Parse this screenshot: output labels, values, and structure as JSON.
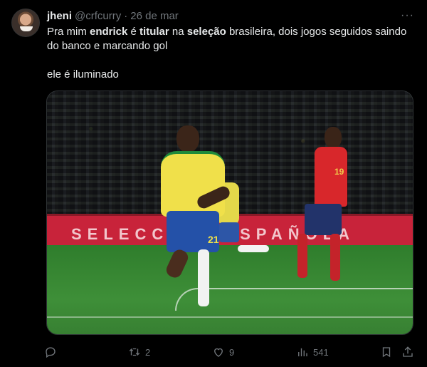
{
  "tweet": {
    "author": {
      "name": "jheni",
      "handle": "@crfcurry",
      "separator": "·",
      "date": "26 de mar"
    },
    "more_label": "···",
    "text": {
      "line1_prefix": "Pra mim ",
      "line1_bold1": "endrick",
      "line1_mid1": " é ",
      "line1_bold2": "titular",
      "line1_mid2": " na ",
      "line1_bold3": "seleção",
      "line1_suffix": " brasileira, dois jogos seguidos saindo do banco e marcando gol",
      "line2": "ele é iluminado"
    },
    "media": {
      "board_text": "SELECCIÓN ESPAÑOLA",
      "brazil_number": "21",
      "spain_number": "19"
    },
    "actions": {
      "reply_count": "",
      "retweet_count": "2",
      "like_count": "9",
      "views_count": "541"
    }
  },
  "icons": [
    "reply-icon",
    "retweet-icon",
    "like-icon",
    "views-icon",
    "bookmark-icon",
    "share-icon",
    "more-icon"
  ],
  "colors": {
    "background": "#000000",
    "text": "#e7e9ea",
    "muted": "#71767b",
    "border": "#2f3336"
  }
}
